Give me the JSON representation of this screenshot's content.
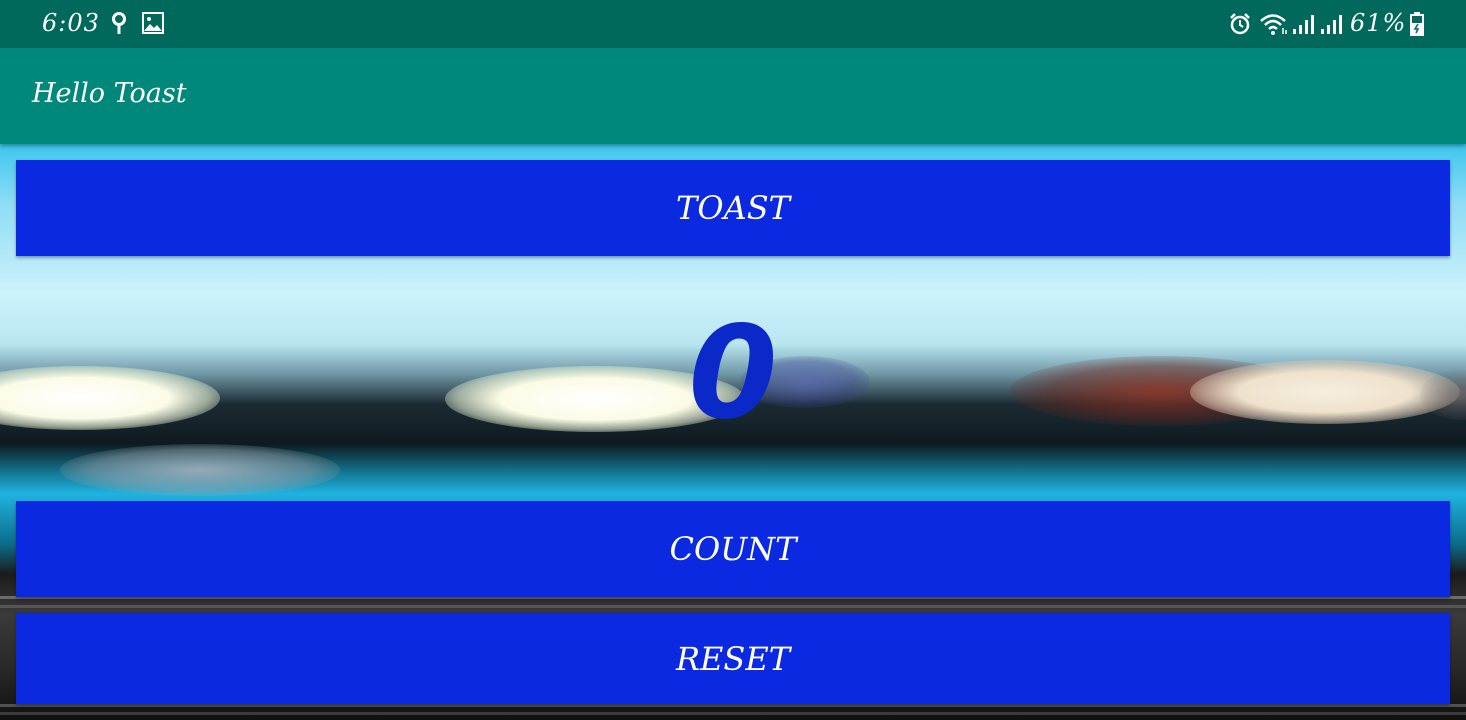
{
  "status_bar": {
    "time": "6:03",
    "battery": "61%",
    "icons": [
      "location-icon",
      "image-icon",
      "alarm-icon",
      "wifi-icon",
      "signal-icon",
      "signal-icon",
      "battery-icon"
    ]
  },
  "app_bar": {
    "title": "Hello Toast"
  },
  "main": {
    "toast_label": "TOAST",
    "count_value": "0",
    "count_label": "COUNT",
    "reset_label": "RESET"
  },
  "colors": {
    "status_bar": "#00695c",
    "app_bar": "#00897b",
    "button": "#0a29e0",
    "count_text": "#0a29c8",
    "text_on_dark": "#ffffff"
  }
}
